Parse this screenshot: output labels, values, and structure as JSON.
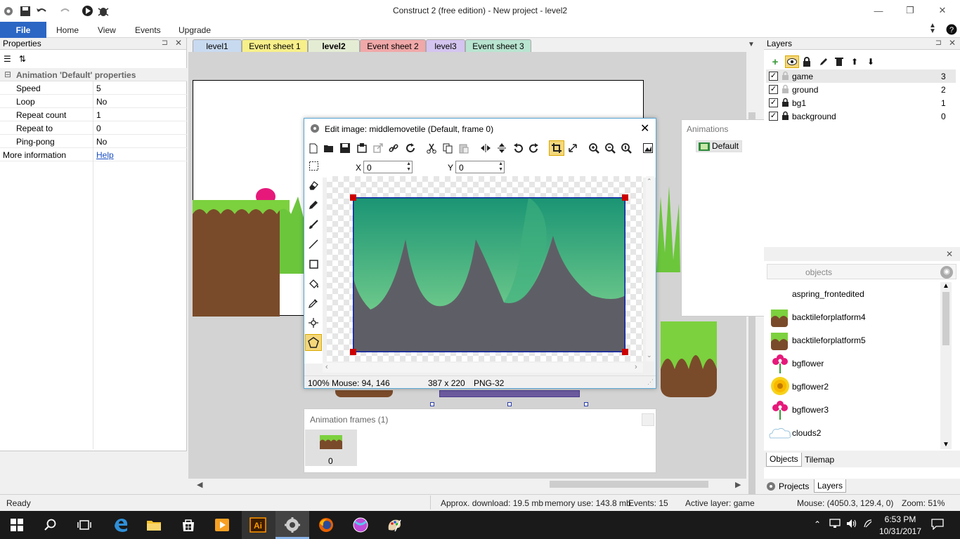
{
  "window": {
    "title": "Construct 2  (free edition) - New project - level2"
  },
  "ribbon": {
    "file": "File",
    "tabs": [
      "Home",
      "View",
      "Events",
      "Upgrade"
    ]
  },
  "properties": {
    "title": "Properties",
    "section": "Animation 'Default' properties",
    "rows": [
      {
        "label": "Speed",
        "value": "5"
      },
      {
        "label": "Loop",
        "value": "No"
      },
      {
        "label": "Repeat count",
        "value": "1"
      },
      {
        "label": "Repeat to",
        "value": "0"
      },
      {
        "label": "Ping-pong",
        "value": "No"
      }
    ],
    "more_label": "More information",
    "more_link": "Help"
  },
  "tabs": [
    {
      "label": "level1",
      "color": "#c8daf0"
    },
    {
      "label": "Event sheet 1",
      "color": "#f7ef8a"
    },
    {
      "label": "level2",
      "color": "#e4ecd4"
    },
    {
      "label": "Event sheet 2",
      "color": "#f0a8a8"
    },
    {
      "label": "level3",
      "color": "#d4c4f0"
    },
    {
      "label": "Event sheet 3",
      "color": "#b8e4d0"
    }
  ],
  "editor": {
    "title": "Edit image: middlemovetile (Default, frame 0)",
    "x_label": "X",
    "x_value": "0",
    "y_label": "Y",
    "y_value": "0",
    "zoom": "100%",
    "mouse": "Mouse: 94, 146",
    "size": "387 x 220",
    "format": "PNG-32"
  },
  "frames": {
    "title": "Animation frames (1)",
    "frame_index": "0"
  },
  "animations": {
    "title": "Animations",
    "item": "Default"
  },
  "layers": {
    "title": "Layers",
    "rows": [
      {
        "name": "game",
        "count": "3",
        "locked": false
      },
      {
        "name": "ground",
        "count": "2",
        "locked": false
      },
      {
        "name": "bg1",
        "count": "1",
        "locked": true
      },
      {
        "name": "background",
        "count": "0",
        "locked": true
      }
    ]
  },
  "objects": {
    "header": "objects",
    "items": [
      {
        "name": "aspring_frontedited",
        "icon": "spring"
      },
      {
        "name": "backtileforplatform4",
        "icon": "tile"
      },
      {
        "name": "backtileforplatform5",
        "icon": "tile"
      },
      {
        "name": "bgflower",
        "icon": "flower-pink"
      },
      {
        "name": "bgflower2",
        "icon": "flower-yellow"
      },
      {
        "name": "bgflower3",
        "icon": "flower-pink"
      },
      {
        "name": "clouds2",
        "icon": "cloud"
      }
    ],
    "tabs": [
      "Objects",
      "Tilemap"
    ],
    "bottom_tabs": [
      "Projects",
      "Layers"
    ]
  },
  "status": {
    "ready": "Ready",
    "download": "Approx. download: 19.5 mb",
    "memory": "memory use: 143.8 mb",
    "events": "Events: 15",
    "layer": "Active layer: game",
    "mouse": "Mouse: (4050.3, 129.4, 0)",
    "zoom": "Zoom: 51%"
  },
  "taskbar": {
    "time": "6:53 PM",
    "date": "10/31/2017"
  }
}
